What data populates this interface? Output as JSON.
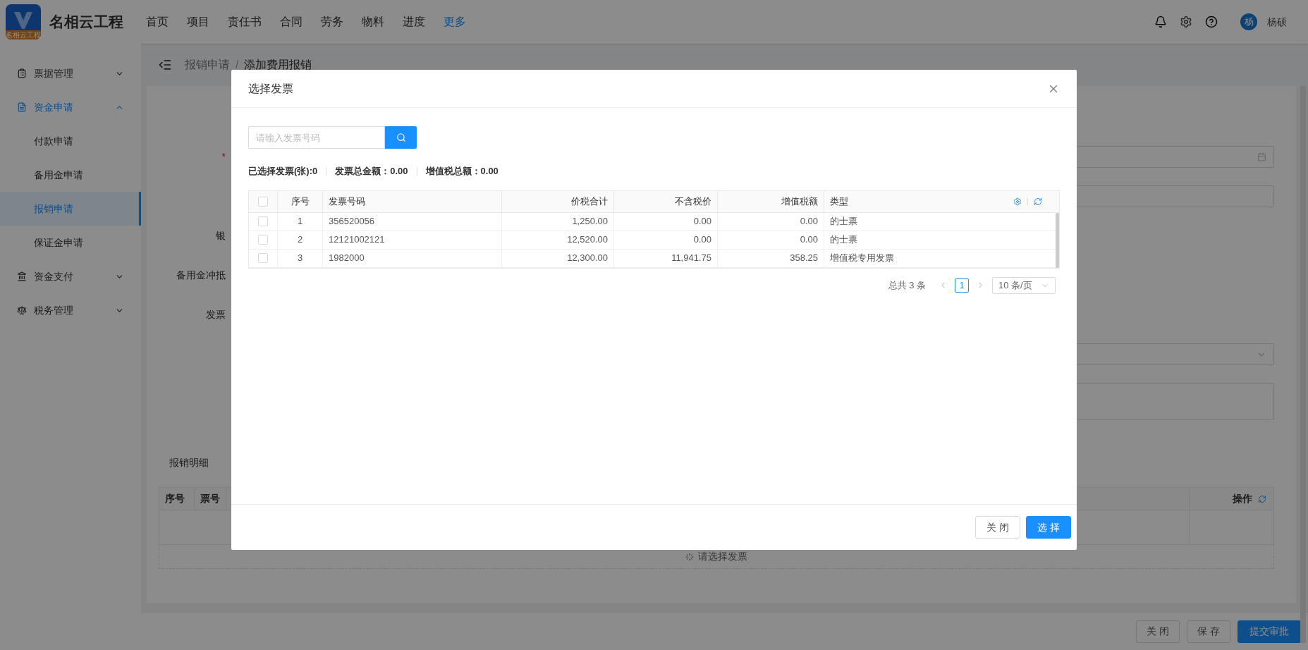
{
  "header": {
    "logo_caption": "名相云工程",
    "app_title": "名相云工程",
    "nav": [
      {
        "label": "首页",
        "selected": false
      },
      {
        "label": "项目",
        "selected": false
      },
      {
        "label": "责任书",
        "selected": false
      },
      {
        "label": "合同",
        "selected": false
      },
      {
        "label": "劳务",
        "selected": false
      },
      {
        "label": "物料",
        "selected": false
      },
      {
        "label": "进度",
        "selected": false
      },
      {
        "label": "更多",
        "selected": true
      }
    ],
    "user": {
      "avatar": "杨",
      "name": "杨硕"
    }
  },
  "sidebar": [
    {
      "label": "票据管理",
      "expanded": false,
      "selected": false
    },
    {
      "label": "资金申请",
      "expanded": true,
      "selected": true,
      "children": [
        {
          "label": "付款申请",
          "selected": false
        },
        {
          "label": "备用金申请",
          "selected": false
        },
        {
          "label": "报销申请",
          "selected": true
        },
        {
          "label": "保证金申请",
          "selected": false
        }
      ]
    },
    {
      "label": "资金支付",
      "expanded": false,
      "selected": false
    },
    {
      "label": "税务管理",
      "expanded": false,
      "selected": false
    }
  ],
  "breadcrumb": {
    "separator": "/",
    "items": [
      "报销申请",
      "添加费用报销"
    ]
  },
  "form": [
    {
      "kind": "date",
      "label": "*",
      "required": true
    },
    {
      "kind": "input"
    },
    {
      "kind": "blank",
      "label": "银"
    },
    {
      "kind": "blank",
      "label": "备用金冲抵"
    },
    {
      "kind": "blank",
      "label": "发票"
    },
    {
      "kind": "select"
    },
    {
      "kind": "textarea"
    }
  ],
  "detail": {
    "title": "报销明细",
    "columns": [
      "序号",
      "票号"
    ],
    "action_column": "操作",
    "empty_text": "请选择发票"
  },
  "footer_buttons": [
    {
      "label": "关 闭",
      "kind": "default"
    },
    {
      "label": "保 存",
      "kind": "default"
    },
    {
      "label": "提交审批",
      "kind": "primary"
    }
  ],
  "modal": {
    "title": "选择发票",
    "search": {
      "placeholder": "请输入发票号码"
    },
    "summary": [
      {
        "label": "已选择发票(张):",
        "value": "0"
      },
      {
        "label": "发票总金额：",
        "value": "0.00"
      },
      {
        "label": "增值税总额：",
        "value": "0.00"
      }
    ],
    "table": {
      "all_checked": false,
      "columns": [
        "序号",
        "发票号码",
        "价税合计",
        "不含税价",
        "增值税额",
        "类型"
      ],
      "rows": [
        {
          "checked": false,
          "cells": [
            "1",
            "356520056",
            "1,250.00",
            "0.00",
            "0.00",
            "的士票"
          ]
        },
        {
          "checked": false,
          "cells": [
            "2",
            "12121002121",
            "12,520.00",
            "0.00",
            "0.00",
            "的士票"
          ]
        },
        {
          "checked": false,
          "cells": [
            "3",
            "1982000",
            "12,300.00",
            "11,941.75",
            "358.25",
            "增值税专用发票"
          ]
        }
      ]
    },
    "pagination": {
      "total": "总共 3 条",
      "pages": [
        {
          "label": "1",
          "selected": true
        }
      ],
      "page_size": "10 条/页"
    },
    "buttons": [
      {
        "label": "关 闭",
        "kind": "default"
      },
      {
        "label": "选 择",
        "kind": "primary"
      }
    ]
  }
}
